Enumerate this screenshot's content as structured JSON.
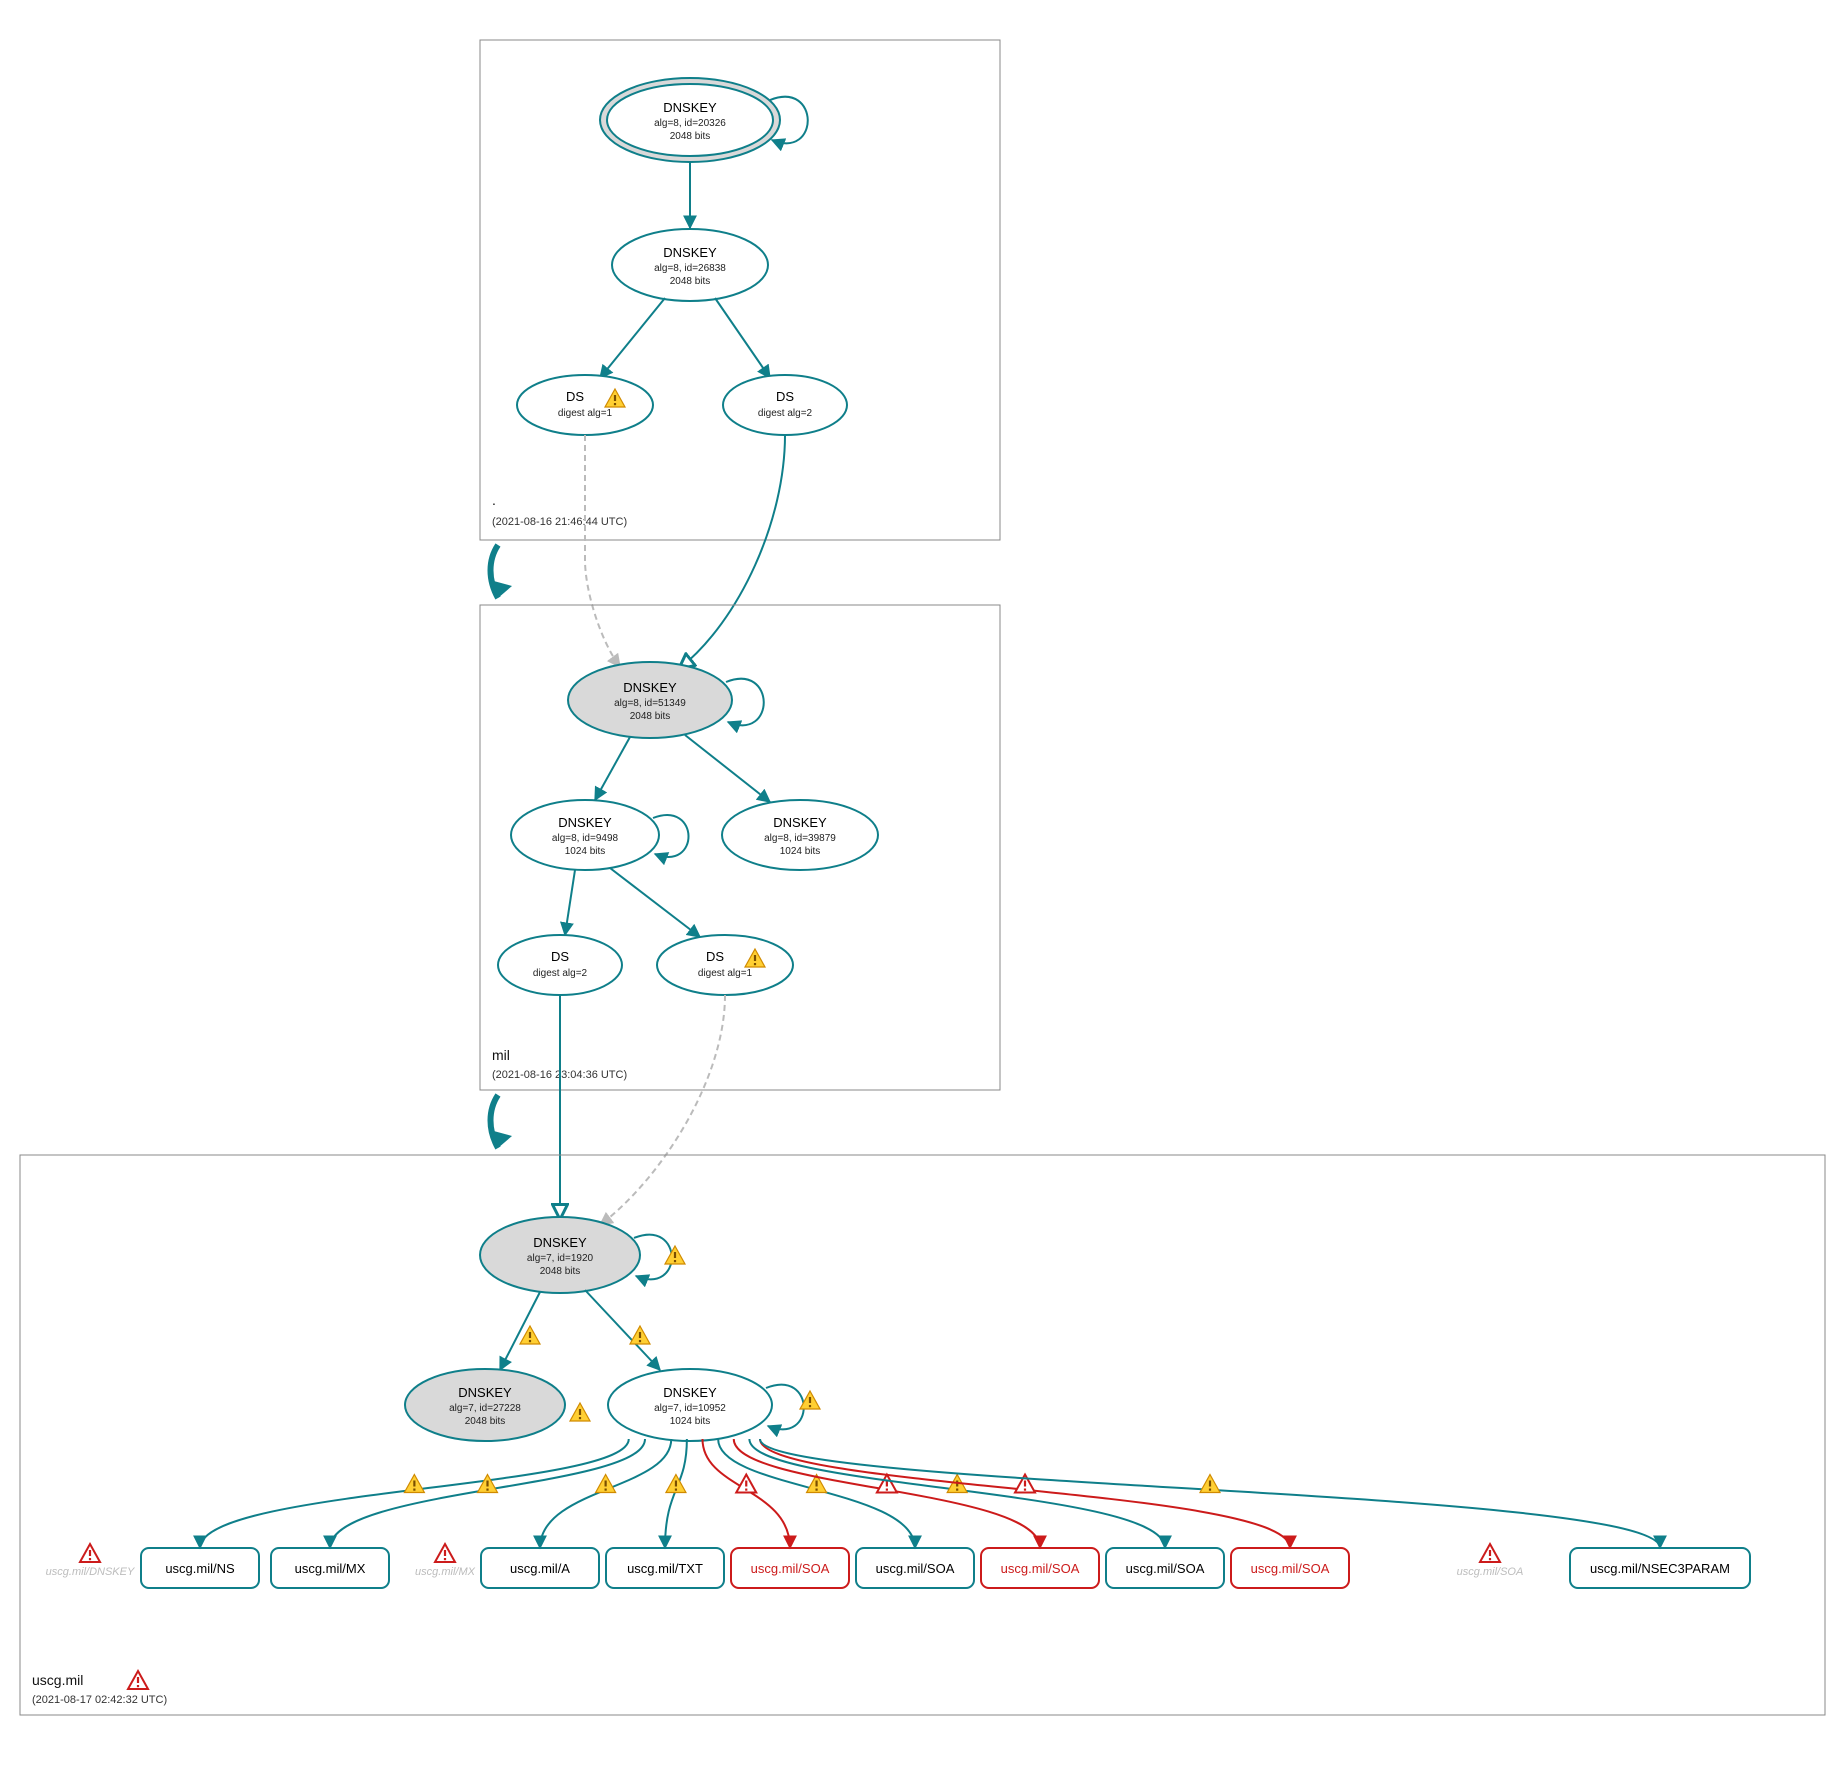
{
  "zones": {
    "root": {
      "name": ".",
      "timestamp": "(2021-08-16 21:46:44 UTC)",
      "nodes": {
        "ksk": {
          "title": "DNSKEY",
          "line1": "alg=8, id=20326",
          "line2": "2048 bits"
        },
        "zsk": {
          "title": "DNSKEY",
          "line1": "alg=8, id=26838",
          "line2": "2048 bits"
        },
        "ds1": {
          "title": "DS",
          "line1": "digest alg=1"
        },
        "ds2": {
          "title": "DS",
          "line1": "digest alg=2"
        }
      }
    },
    "mil": {
      "name": "mil",
      "timestamp": "(2021-08-16 23:04:36 UTC)",
      "nodes": {
        "ksk": {
          "title": "DNSKEY",
          "line1": "alg=8, id=51349",
          "line2": "2048 bits"
        },
        "zsk1": {
          "title": "DNSKEY",
          "line1": "alg=8, id=9498",
          "line2": "1024 bits"
        },
        "zsk2": {
          "title": "DNSKEY",
          "line1": "alg=8, id=39879",
          "line2": "1024 bits"
        },
        "ds1": {
          "title": "DS",
          "line1": "digest alg=2"
        },
        "ds2": {
          "title": "DS",
          "line1": "digest alg=1"
        }
      }
    },
    "uscg": {
      "name": "uscg.mil",
      "timestamp": "(2021-08-17 02:42:32 UTC)",
      "nodes": {
        "ksk": {
          "title": "DNSKEY",
          "line1": "alg=7, id=1920",
          "line2": "2048 bits"
        },
        "key2": {
          "title": "DNSKEY",
          "line1": "alg=7, id=27228",
          "line2": "2048 bits"
        },
        "zsk": {
          "title": "DNSKEY",
          "line1": "alg=7, id=10952",
          "line2": "1024 bits"
        }
      },
      "rrsets": [
        {
          "label": "uscg.mil/NS",
          "status": "ok"
        },
        {
          "label": "uscg.mil/MX",
          "status": "ok"
        },
        {
          "label": "uscg.mil/A",
          "status": "ok"
        },
        {
          "label": "uscg.mil/TXT",
          "status": "ok"
        },
        {
          "label": "uscg.mil/SOA",
          "status": "err"
        },
        {
          "label": "uscg.mil/SOA",
          "status": "ok"
        },
        {
          "label": "uscg.mil/SOA",
          "status": "err"
        },
        {
          "label": "uscg.mil/SOA",
          "status": "ok"
        },
        {
          "label": "uscg.mil/SOA",
          "status": "err"
        },
        {
          "label": "uscg.mil/NSEC3PARAM",
          "status": "ok"
        }
      ],
      "extras": {
        "dnskey": "uscg.mil/DNSKEY",
        "mx": "uscg.mil/MX",
        "soa": "uscg.mil/SOA"
      }
    }
  }
}
